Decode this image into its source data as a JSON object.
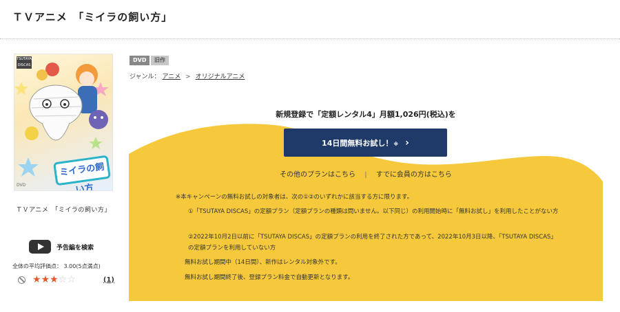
{
  "page": {
    "title": "ＴＶアニメ　「ミイラの飼い方」"
  },
  "cover": {
    "alt": "ミイラの飼い方 DVD cover",
    "badge": "DVD",
    "logo_text": "ミイラの飼い方",
    "caption": "ＴＶアニメ　「ミイラの飼い方」"
  },
  "trailer": {
    "label": "予告編を検索",
    "icon": "play-icon"
  },
  "rating": {
    "summary": "全体の平均評価点： 3.00(5点満点)",
    "stars": 3,
    "max_stars": 5,
    "review_count": "(1)",
    "star_color": "#e35a2a"
  },
  "tags": {
    "format": "DVD",
    "status": "旧作"
  },
  "genre": {
    "label": "ジャンル：",
    "level1": "アニメ",
    "separator": ">",
    "level2": "オリジナルアニメ"
  },
  "promo": {
    "background_color": "#f6c93c",
    "headline": "新規登録で「定額レンタル4」月額1,026円(税込)を",
    "button_label": "14日間無料お試し！",
    "button_note": "※",
    "button_color": "#1f3a68",
    "other_plans": "その他のプランはこちら",
    "divider": "|",
    "member_link": "すでに会員の方はこちら",
    "notice": "※本キャンペーンの無料お試しの対象者は、次の①②のいずれかに該当する方に限ります。",
    "condition1": "①「TSUTAYA DISCAS」の定額プラン（定額プランの種類は問いません。以下同じ）の利用開始時に「無料お試し」を利用したことがない方",
    "condition2": "②2022年10月2日以前に「TSUTAYA DISCAS」の定額プランの利用を終了された方であって、2022年10月3日以降、「TSUTAYA DISCAS」の定額プランを利用していない方",
    "note1": "無料お試し期間中（14日間）、新作はレンタル対象外です。",
    "note2": "無料お試し期間終了後、登録プラン料金で自動更新となります。"
  }
}
